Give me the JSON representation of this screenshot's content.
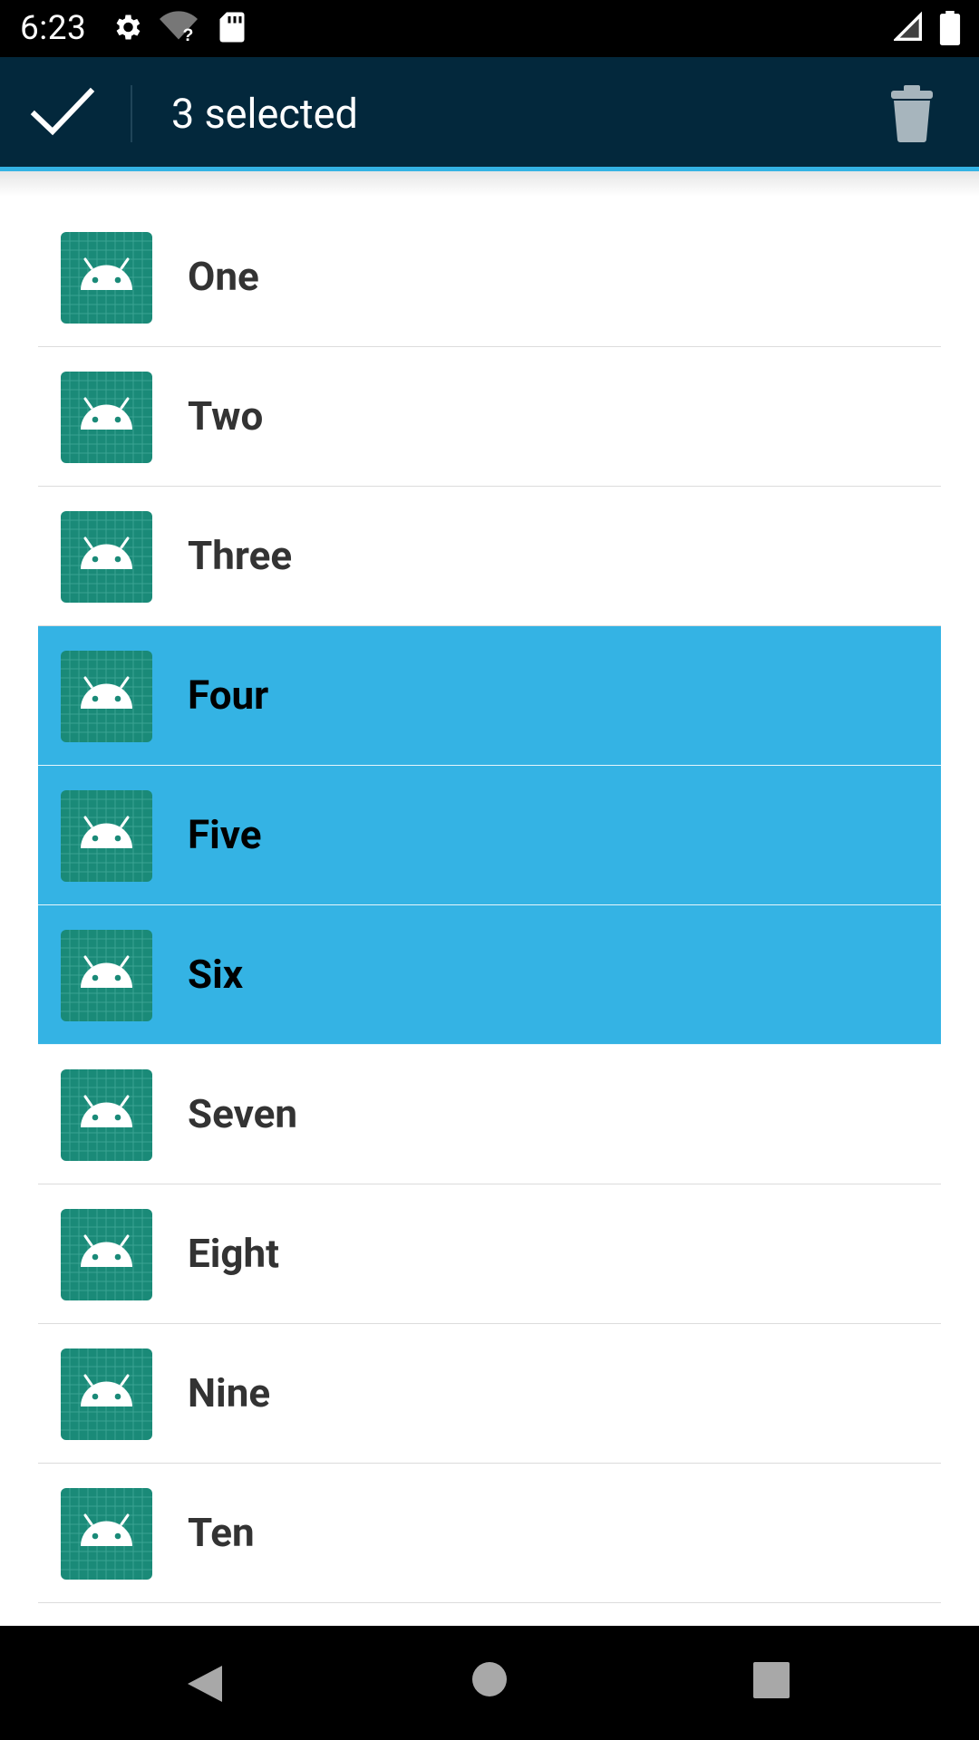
{
  "status_bar": {
    "time": "6:23",
    "icons": [
      "settings-icon",
      "wifi-unknown-icon",
      "sd-card-icon",
      "signal-icon",
      "battery-icon"
    ]
  },
  "action_bar": {
    "title": "3 selected",
    "done_icon": "check-icon",
    "delete_icon": "trash-icon",
    "background": "#03283c",
    "accent": "#34b3e4"
  },
  "list": {
    "selected_color": "#34b3e4",
    "items": [
      {
        "label": "One",
        "selected": false
      },
      {
        "label": "Two",
        "selected": false
      },
      {
        "label": "Three",
        "selected": false
      },
      {
        "label": "Four",
        "selected": true
      },
      {
        "label": "Five",
        "selected": true
      },
      {
        "label": "Six",
        "selected": true
      },
      {
        "label": "Seven",
        "selected": false
      },
      {
        "label": "Eight",
        "selected": false
      },
      {
        "label": "Nine",
        "selected": false
      },
      {
        "label": "Ten",
        "selected": false
      }
    ]
  },
  "nav_bar": {
    "icons": [
      "back-icon",
      "home-icon",
      "recents-icon"
    ]
  }
}
